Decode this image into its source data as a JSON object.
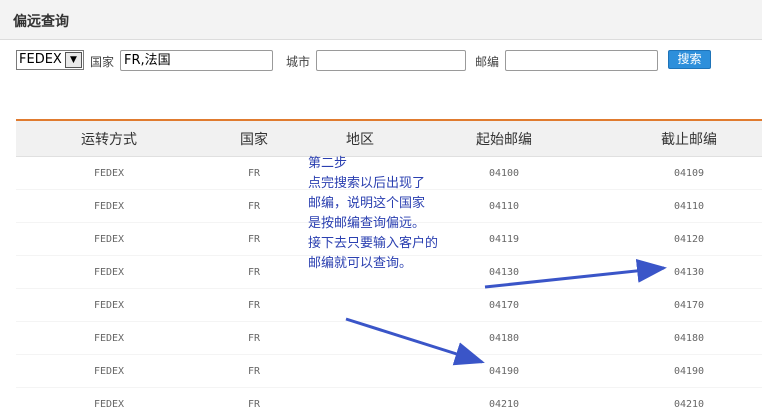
{
  "header": {
    "title": "偏远查询"
  },
  "search": {
    "carrier": "FEDEX",
    "country_label": "国家",
    "country_value": "FR,法国",
    "city_label": "城市",
    "city_value": "",
    "postcode_label": "邮编",
    "postcode_value": "",
    "search_button": "搜索"
  },
  "table": {
    "headers": [
      "运转方式",
      "国家",
      "地区",
      "起始邮编",
      "截止邮编"
    ],
    "rows": [
      [
        "FEDEX",
        "FR",
        "",
        "04100",
        "04109"
      ],
      [
        "FEDEX",
        "FR",
        "",
        "04110",
        "04110"
      ],
      [
        "FEDEX",
        "FR",
        "",
        "04119",
        "04120"
      ],
      [
        "FEDEX",
        "FR",
        "",
        "04130",
        "04130"
      ],
      [
        "FEDEX",
        "FR",
        "",
        "04170",
        "04170"
      ],
      [
        "FEDEX",
        "FR",
        "",
        "04180",
        "04180"
      ],
      [
        "FEDEX",
        "FR",
        "",
        "04190",
        "04190"
      ],
      [
        "FEDEX",
        "FR",
        "",
        "04210",
        "04210"
      ]
    ]
  },
  "annotation": {
    "lines": [
      "第二步",
      "点完搜索以后出现了",
      "邮编，说明这个国家",
      "是按邮编查询偏远。",
      "接下去只要输入客户的",
      "邮编就可以查询。"
    ],
    "color": "#2a3fb0"
  },
  "colors": {
    "accent": "#e07b2f",
    "button": "#2d8fdb"
  }
}
